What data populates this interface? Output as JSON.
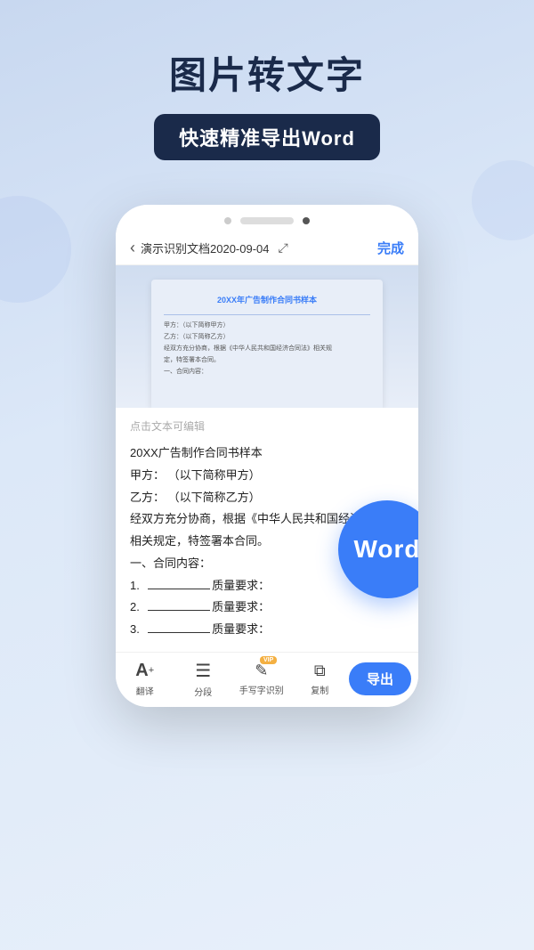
{
  "header": {
    "main_title": "图片转文字",
    "sub_title": "快速精准导出Word"
  },
  "phone": {
    "speaker_shape": "speaker",
    "dot_left": "dot",
    "dot_right": "dot"
  },
  "nav": {
    "back_arrow": "‹",
    "title": "演示识别文档2020-09-04",
    "export_icon": "⤢",
    "done_label": "完成"
  },
  "doc_preview": {
    "heading": "20XX年广告制作合同书样本",
    "lines": [
      "甲方：（以下简称甲方）",
      "乙方：（以下简称乙方）",
      "经双方充分协商，根据《中华人民共和国经济合同法》相关规",
      "定，特签署本合同。",
      "一、合同内容："
    ]
  },
  "text_area": {
    "editable_hint": "点击文本可编辑",
    "content_lines": [
      "20XX广告制作合同书样本",
      "甲方：  （以下简称甲方）",
      "乙方：  （以下简称乙方）",
      "经双方充分协商，根据《中华人民共和国经济合同法》",
      "相关规定，特签署本合同。",
      "一、合同内容：",
      "1. _______________质量要求：",
      "2. _______________质量要求：",
      "3. _______________质量要求："
    ]
  },
  "word_badge": {
    "text": "Word"
  },
  "toolbar": {
    "items": [
      {
        "icon": "A+",
        "label": "翻译",
        "has_vip": false
      },
      {
        "icon": "≡",
        "label": "分段",
        "has_vip": false
      },
      {
        "icon": "✎",
        "label": "手写字识别",
        "has_vip": true
      },
      {
        "icon": "⧉",
        "label": "复制",
        "has_vip": false
      }
    ],
    "export_label": "导出"
  }
}
